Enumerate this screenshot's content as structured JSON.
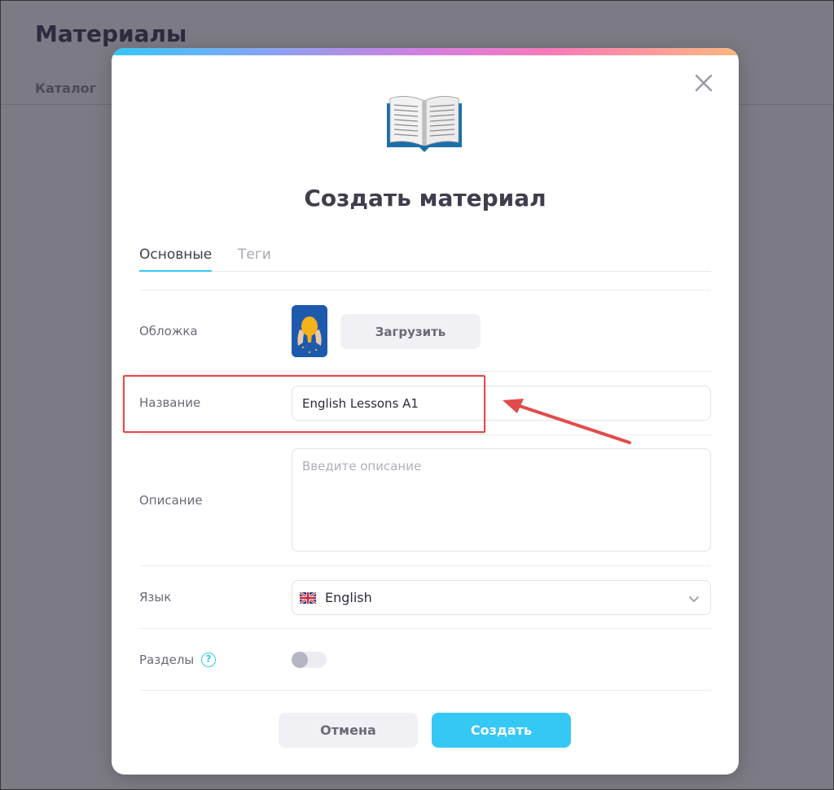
{
  "background": {
    "page_title": "Материалы",
    "tab": "Каталог"
  },
  "modal": {
    "title": "Создать материал",
    "tabs": [
      {
        "label": "Основные",
        "active": true
      },
      {
        "label": "Теги",
        "active": false
      }
    ],
    "fields": {
      "cover": {
        "label": "Обложка",
        "upload_label": "Загрузить"
      },
      "name": {
        "label": "Название",
        "value": "English Lessons A1"
      },
      "description": {
        "label": "Описание",
        "placeholder": "Введите описание",
        "value": ""
      },
      "language": {
        "label": "Язык",
        "value": "English",
        "flag_icon": "uk-flag-icon"
      },
      "sections": {
        "label": "Разделы",
        "help": "?",
        "enabled": false
      }
    },
    "buttons": {
      "cancel": "Отмена",
      "create": "Создать"
    }
  },
  "colors": {
    "accent": "#35c8f5",
    "annotation": "#e24b4b",
    "overlay": "#7c7b85"
  }
}
